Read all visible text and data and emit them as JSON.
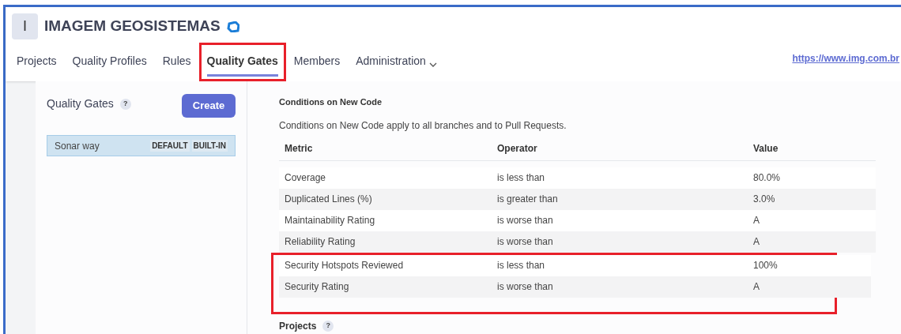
{
  "organization": {
    "avatar_letter": "I",
    "name": "IMAGEM GEOSISTEMAS"
  },
  "nav": [
    {
      "label": "Projects",
      "selected": false,
      "highlighted": false,
      "dropdown": false
    },
    {
      "label": "Quality Profiles",
      "selected": false,
      "highlighted": false,
      "dropdown": false
    },
    {
      "label": "Rules",
      "selected": false,
      "highlighted": false,
      "dropdown": false
    },
    {
      "label": "Quality Gates",
      "selected": true,
      "highlighted": true,
      "dropdown": false
    },
    {
      "label": "Members",
      "selected": false,
      "highlighted": false,
      "dropdown": false
    },
    {
      "label": "Administration",
      "selected": false,
      "highlighted": false,
      "dropdown": true
    }
  ],
  "website_link": "https://www.img.com.br",
  "sidebar": {
    "title": "Quality Gates",
    "help": "?",
    "create_button": "Create",
    "gates": [
      {
        "name": "Sonar way",
        "badges": [
          "DEFAULT",
          "BUILT-IN"
        ],
        "selected": true
      }
    ]
  },
  "conditions": {
    "title": "Conditions on New Code",
    "description": "Conditions on New Code apply to all branches and to Pull Requests.",
    "columns": [
      "Metric",
      "Operator",
      "Value"
    ],
    "rows": [
      {
        "metric": "Coverage",
        "operator": "is less than",
        "value": "80.0%",
        "highlighted": false
      },
      {
        "metric": "Duplicated Lines (%)",
        "operator": "is greater than",
        "value": "3.0%",
        "highlighted": false
      },
      {
        "metric": "Maintainability Rating",
        "operator": "is worse than",
        "value": "A",
        "highlighted": false
      },
      {
        "metric": "Reliability Rating",
        "operator": "is worse than",
        "value": "A",
        "highlighted": false
      },
      {
        "metric": "Security Hotspots Reviewed",
        "operator": "is less than",
        "value": "100%",
        "highlighted": true
      },
      {
        "metric": "Security Rating",
        "operator": "is worse than",
        "value": "A",
        "highlighted": true
      }
    ]
  },
  "projects": {
    "title": "Projects",
    "help": "?"
  }
}
